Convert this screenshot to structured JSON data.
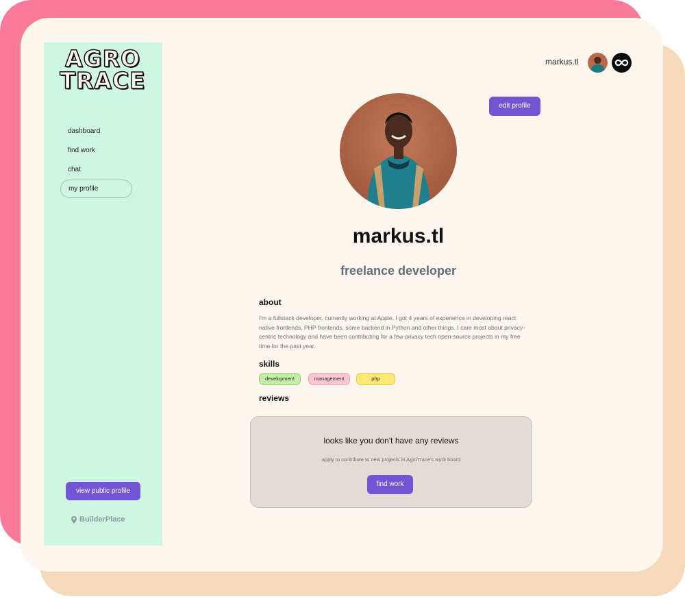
{
  "brand": {
    "logo_line1": "AGRO",
    "logo_line2": "TRACE",
    "footer_name": "BuilderPlace"
  },
  "sidebar": {
    "items": [
      {
        "label": "dashboard",
        "active": false
      },
      {
        "label": "find work",
        "active": false
      },
      {
        "label": "chat",
        "active": false
      },
      {
        "label": "my profile",
        "active": true
      }
    ],
    "public_profile_label": "view public profile"
  },
  "header": {
    "username": "markus.tl",
    "avatar_icon": "user-avatar",
    "link_icon": "infinity-link-icon"
  },
  "profile": {
    "edit_label": "edit profile",
    "name": "markus.tl",
    "role": "freelance developer",
    "about_title": "about",
    "about_text": "I'm a fullstack developer, currently working at Apple. I got 4 years of experience in developing react native frontends, PHP frontends, some backend in Python and other things. I care most about privacy-centric technology and have been contributing for a few privacy tech open-source projects in my free time for the past year.",
    "skills_title": "skills",
    "skills": [
      "development",
      "management",
      "php"
    ],
    "reviews_title": "reviews"
  },
  "reviews": {
    "empty_title": "looks like you don't have any reviews",
    "empty_subtitle": "apply to contribute to new projects in AgroTrace's work board",
    "find_work_label": "find work"
  },
  "colors": {
    "accent": "#7155d4",
    "sidebar_bg": "#cff6e2",
    "card_bg": "#fdf6ef",
    "frame_pink": "#fa7a9c",
    "frame_peach": "#f5d9bb"
  }
}
